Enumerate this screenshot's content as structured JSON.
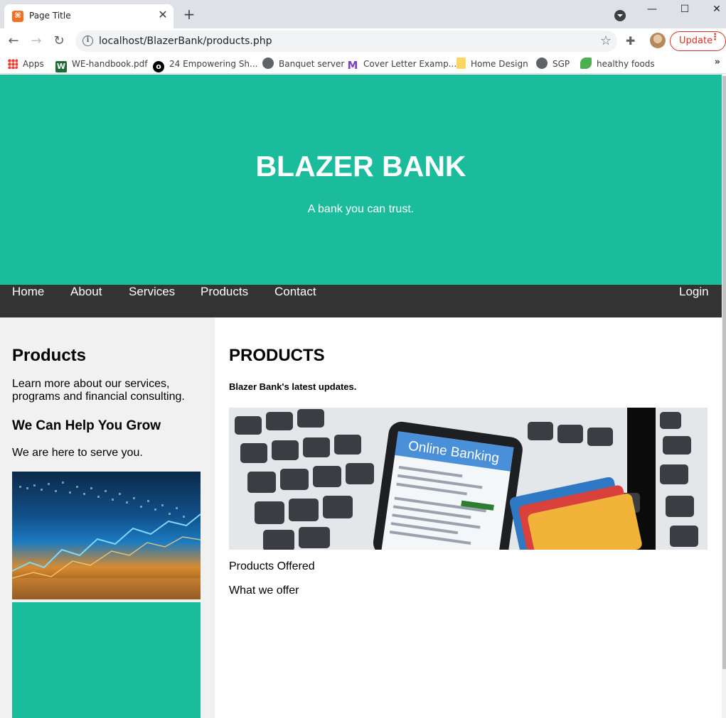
{
  "browser": {
    "tab_title": "Page Title",
    "tab_close": "✕",
    "new_tab": "+",
    "url": "localhost/BlazerBank/products.php",
    "update_label": "Update",
    "window_controls": [
      "—",
      "☐",
      "✕"
    ],
    "bookmarks": [
      {
        "label": "Apps",
        "icon": "apps-grid-icon"
      },
      {
        "label": "WE-handbook.pdf",
        "icon": "word-doc-icon"
      },
      {
        "label": "24 Empowering Sh...",
        "icon": "bubble-icon"
      },
      {
        "label": "Banquet server",
        "icon": "globe-icon"
      },
      {
        "label": "Cover Letter Examp...",
        "icon": "m-logo-icon"
      },
      {
        "label": "Home Design",
        "icon": "sticky-note-icon"
      },
      {
        "label": "SGP",
        "icon": "globe-icon"
      },
      {
        "label": "healthy foods",
        "icon": "leaf-icon"
      }
    ]
  },
  "hero": {
    "title": "BLAZER BANK",
    "tagline": "A bank you can trust."
  },
  "nav": {
    "items": [
      "Home",
      "About",
      "Services",
      "Products",
      "Contact"
    ],
    "login": "Login"
  },
  "sidebar": {
    "heading": "Products",
    "intro": "Learn more about our services, programs and financial consulting.",
    "subheading": "We Can Help You Grow",
    "text": "We are here to serve you."
  },
  "main": {
    "heading": "PRODUCTS",
    "subheading": "Blazer Bank's latest updates.",
    "banner_text": "Online Banking",
    "line1": "Products Offered",
    "line2": "What we offer"
  },
  "colors": {
    "accent": "#1abc9c",
    "navbar": "#333333",
    "sidebar_bg": "#f1f1f1"
  }
}
